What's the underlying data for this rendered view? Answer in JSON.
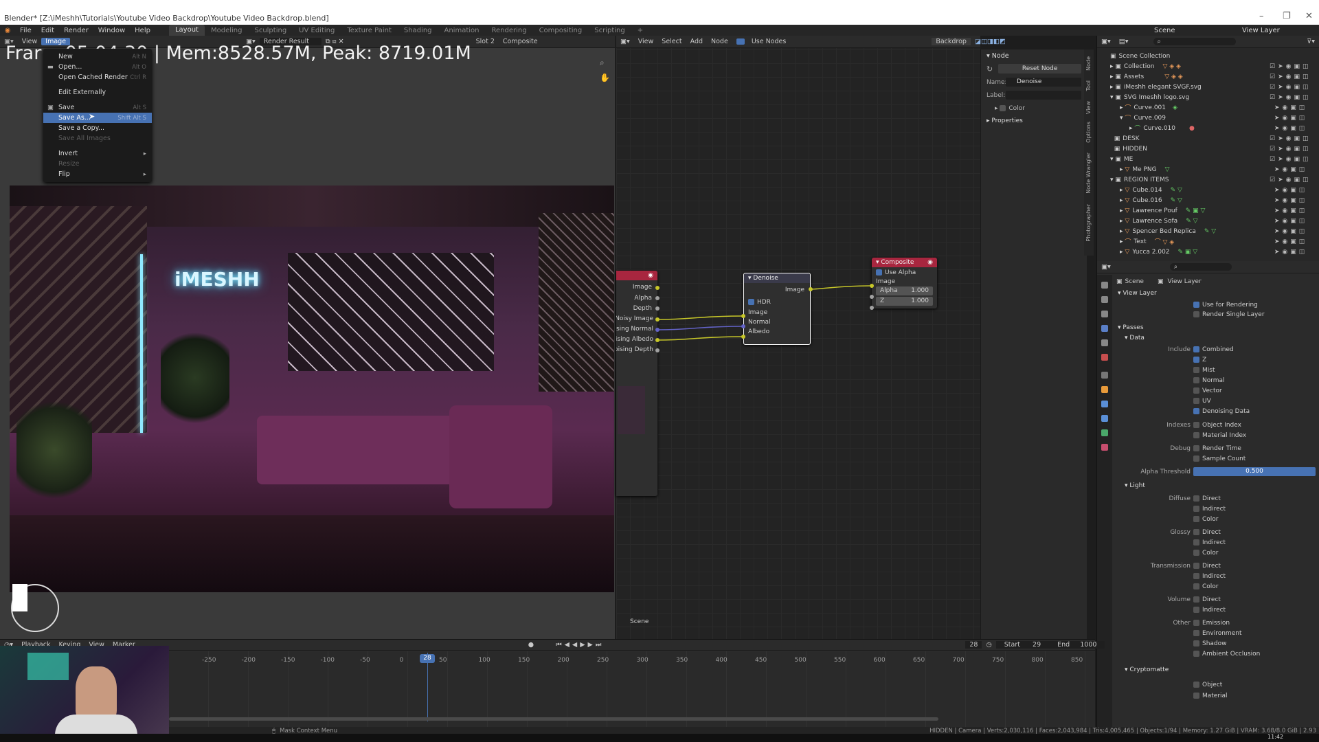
{
  "window": {
    "title": "Blender* [Z:\\iMeshh\\Tutorials\\Youtube Video Backdrop\\Youtube Video Backdrop.blend]",
    "min": "–",
    "max": "❐",
    "close": "✕"
  },
  "menubar": {
    "items": [
      "File",
      "Edit",
      "Render",
      "Window",
      "Help"
    ],
    "workspaces": [
      "Layout",
      "Modeling",
      "Sculpting",
      "UV Editing",
      "Texture Paint",
      "Shading",
      "Animation",
      "Rendering",
      "Compositing",
      "Scripting"
    ],
    "add": "+",
    "scene": "Scene",
    "view_layer": "View Layer"
  },
  "image_editor": {
    "header": {
      "view": "View",
      "image": "Image",
      "render_result": "Render Result",
      "slot": "Slot 2",
      "composite": "Composite"
    },
    "overlay_text": "Frar          e:05:04.30 | Mem:8528.57M, Peak: 8719.01M",
    "neon": "iMESHH"
  },
  "image_menu": {
    "items": [
      {
        "label": "New",
        "shortcut": "Alt N",
        "state": "normal"
      },
      {
        "label": "Open...",
        "shortcut": "Alt O",
        "state": "normal"
      },
      {
        "label": "Open Cached Render",
        "shortcut": "Ctrl R",
        "state": "normal"
      },
      {
        "label": "Edit Externally",
        "shortcut": "",
        "state": "normal"
      },
      {
        "label": "Save",
        "shortcut": "Alt S",
        "state": "normal"
      },
      {
        "label": "Save As...",
        "shortcut": "Shift Alt S",
        "state": "highlighted"
      },
      {
        "label": "Save a Copy...",
        "shortcut": "",
        "state": "normal"
      },
      {
        "label": "Save All Images",
        "shortcut": "",
        "state": "disabled"
      },
      {
        "label": "Invert",
        "shortcut": "",
        "state": "normal"
      },
      {
        "label": "Resize",
        "shortcut": "",
        "state": "disabled"
      },
      {
        "label": "Flip",
        "shortcut": "",
        "state": "normal"
      }
    ]
  },
  "node_editor": {
    "header": {
      "view": "View",
      "select": "Select",
      "add": "Add",
      "node": "Node",
      "use_nodes": "Use Nodes",
      "backdrop": "Backdrop"
    },
    "footer": "Scene",
    "render_layers_outputs": [
      "Image",
      "Alpha",
      "Depth",
      "Noisy Image",
      "Denoising Normal",
      "Denoising Albedo",
      "Denoising Depth"
    ],
    "denoise": {
      "title": "Denoise",
      "output": "Image",
      "hdr": "HDR",
      "inputs": [
        "Image",
        "Normal",
        "Albedo"
      ]
    },
    "composite": {
      "title": "Composite",
      "use_alpha": "Use Alpha",
      "inputs": [
        {
          "label": "Image",
          "value": ""
        },
        {
          "label": "Alpha",
          "value": "1.000"
        },
        {
          "label": "Z",
          "value": "1.000"
        }
      ]
    }
  },
  "n_panel": {
    "title": "Node",
    "reset": "Reset Node",
    "name_label": "Name:",
    "name_value": "Denoise",
    "label_label": "Label:",
    "color": "Color",
    "properties": "Properties",
    "tabs": [
      "Node",
      "Tool",
      "View",
      "Options",
      "Node Wrangler",
      "Photographer"
    ]
  },
  "outliner": {
    "items": [
      {
        "label": "Scene Collection",
        "depth": 0
      },
      {
        "label": "Collection",
        "depth": 1
      },
      {
        "label": "Assets",
        "depth": 1
      },
      {
        "label": "iMeshh elegant SVGF.svg",
        "depth": 1
      },
      {
        "label": "SVG Imeshh logo.svg",
        "depth": 1
      },
      {
        "label": "Curve.001",
        "depth": 2
      },
      {
        "label": "Curve.009",
        "depth": 2
      },
      {
        "label": "Curve.010",
        "depth": 3
      },
      {
        "label": "DESK",
        "depth": 1
      },
      {
        "label": "HIDDEN",
        "depth": 1
      },
      {
        "label": "ME",
        "depth": 1
      },
      {
        "label": "Me PNG",
        "depth": 2
      },
      {
        "label": "REGION ITEMS",
        "depth": 1
      },
      {
        "label": "Cube.014",
        "depth": 2
      },
      {
        "label": "Cube.016",
        "depth": 2
      },
      {
        "label": "Lawrence Pouf",
        "depth": 2
      },
      {
        "label": "Lawrence Sofa",
        "depth": 2
      },
      {
        "label": "Spencer Bed Replica",
        "depth": 2
      },
      {
        "label": "Text",
        "depth": 2
      },
      {
        "label": "Yucca 2.002",
        "depth": 2
      }
    ]
  },
  "properties": {
    "breadcrumb": [
      "Scene",
      "View Layer"
    ],
    "view_layer": "View Layer",
    "use_for_rendering": "Use for Rendering",
    "render_single_layer": "Render Single Layer",
    "passes": "Passes",
    "data": "Data",
    "include_label": "Include",
    "include": [
      {
        "label": "Combined",
        "on": true
      },
      {
        "label": "Z",
        "on": true
      },
      {
        "label": "Mist",
        "on": false
      },
      {
        "label": "Normal",
        "on": false
      },
      {
        "label": "Vector",
        "on": false
      },
      {
        "label": "UV",
        "on": false
      },
      {
        "label": "Denoising Data",
        "on": true
      }
    ],
    "indexes_label": "Indexes",
    "indexes": [
      "Object Index",
      "Material Index"
    ],
    "debug_label": "Debug",
    "debug": [
      "Render Time",
      "Sample Count"
    ],
    "alpha_label": "Alpha Threshold",
    "alpha_value": "0.500",
    "light": "Light",
    "light_groups": [
      {
        "label": "Diffuse",
        "items": [
          "Direct",
          "Indirect",
          "Color"
        ]
      },
      {
        "label": "Glossy",
        "items": [
          "Direct",
          "Indirect",
          "Color"
        ]
      },
      {
        "label": "Transmission",
        "items": [
          "Direct",
          "Indirect",
          "Color"
        ]
      },
      {
        "label": "Volume",
        "items": [
          "Direct",
          "Indirect"
        ]
      },
      {
        "label": "Other",
        "items": [
          "Emission",
          "Environment",
          "Shadow",
          "Ambient Occlusion"
        ]
      }
    ],
    "cryptomatte": "Cryptomatte",
    "crypto_items": [
      "Object",
      "Material"
    ]
  },
  "timeline": {
    "menu": [
      "Playback",
      "Keying",
      "View",
      "Marker"
    ],
    "current_frame": "28",
    "start_label": "Start",
    "start": "29",
    "end_label": "End",
    "end": "1000",
    "ticks": [
      "-250",
      "-200",
      "-150",
      "-100",
      "-50",
      "0",
      "28",
      "50",
      "100",
      "150",
      "200",
      "250",
      "300",
      "350",
      "400",
      "450",
      "500",
      "550",
      "600",
      "650",
      "700",
      "750",
      "800",
      "850"
    ]
  },
  "statusbar": {
    "left": "Mask Context Menu",
    "right": "HIDDEN | Camera | Verts:2,030,116 | Faces:2,043,984 | Tris:4,005,465 | Objects:1/94 | Memory: 1.27 GiB | VRAM: 3.68/8.0 GiB | 2.93"
  },
  "taskbar": {
    "time": "11:42"
  }
}
